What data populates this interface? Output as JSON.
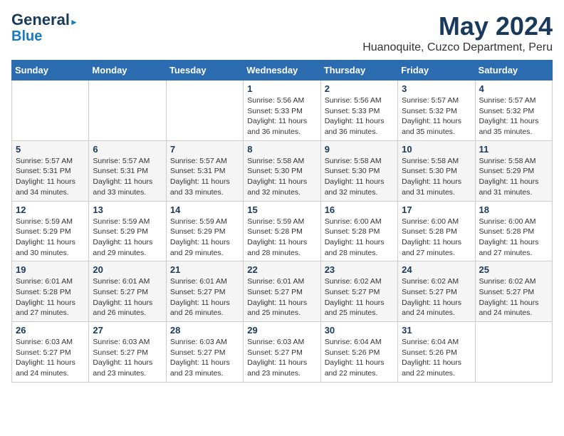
{
  "header": {
    "logo_line1": "General",
    "logo_line2": "Blue",
    "title": "May 2024",
    "subtitle": "Huanoquite, Cuzco Department, Peru"
  },
  "weekdays": [
    "Sunday",
    "Monday",
    "Tuesday",
    "Wednesday",
    "Thursday",
    "Friday",
    "Saturday"
  ],
  "weeks": [
    [
      {
        "day": "",
        "info": ""
      },
      {
        "day": "",
        "info": ""
      },
      {
        "day": "",
        "info": ""
      },
      {
        "day": "1",
        "info": "Sunrise: 5:56 AM\nSunset: 5:33 PM\nDaylight: 11 hours and 36 minutes."
      },
      {
        "day": "2",
        "info": "Sunrise: 5:56 AM\nSunset: 5:33 PM\nDaylight: 11 hours and 36 minutes."
      },
      {
        "day": "3",
        "info": "Sunrise: 5:57 AM\nSunset: 5:32 PM\nDaylight: 11 hours and 35 minutes."
      },
      {
        "day": "4",
        "info": "Sunrise: 5:57 AM\nSunset: 5:32 PM\nDaylight: 11 hours and 35 minutes."
      }
    ],
    [
      {
        "day": "5",
        "info": "Sunrise: 5:57 AM\nSunset: 5:31 PM\nDaylight: 11 hours and 34 minutes."
      },
      {
        "day": "6",
        "info": "Sunrise: 5:57 AM\nSunset: 5:31 PM\nDaylight: 11 hours and 33 minutes."
      },
      {
        "day": "7",
        "info": "Sunrise: 5:57 AM\nSunset: 5:31 PM\nDaylight: 11 hours and 33 minutes."
      },
      {
        "day": "8",
        "info": "Sunrise: 5:58 AM\nSunset: 5:30 PM\nDaylight: 11 hours and 32 minutes."
      },
      {
        "day": "9",
        "info": "Sunrise: 5:58 AM\nSunset: 5:30 PM\nDaylight: 11 hours and 32 minutes."
      },
      {
        "day": "10",
        "info": "Sunrise: 5:58 AM\nSunset: 5:30 PM\nDaylight: 11 hours and 31 minutes."
      },
      {
        "day": "11",
        "info": "Sunrise: 5:58 AM\nSunset: 5:29 PM\nDaylight: 11 hours and 31 minutes."
      }
    ],
    [
      {
        "day": "12",
        "info": "Sunrise: 5:59 AM\nSunset: 5:29 PM\nDaylight: 11 hours and 30 minutes."
      },
      {
        "day": "13",
        "info": "Sunrise: 5:59 AM\nSunset: 5:29 PM\nDaylight: 11 hours and 29 minutes."
      },
      {
        "day": "14",
        "info": "Sunrise: 5:59 AM\nSunset: 5:29 PM\nDaylight: 11 hours and 29 minutes."
      },
      {
        "day": "15",
        "info": "Sunrise: 5:59 AM\nSunset: 5:28 PM\nDaylight: 11 hours and 28 minutes."
      },
      {
        "day": "16",
        "info": "Sunrise: 6:00 AM\nSunset: 5:28 PM\nDaylight: 11 hours and 28 minutes."
      },
      {
        "day": "17",
        "info": "Sunrise: 6:00 AM\nSunset: 5:28 PM\nDaylight: 11 hours and 27 minutes."
      },
      {
        "day": "18",
        "info": "Sunrise: 6:00 AM\nSunset: 5:28 PM\nDaylight: 11 hours and 27 minutes."
      }
    ],
    [
      {
        "day": "19",
        "info": "Sunrise: 6:01 AM\nSunset: 5:28 PM\nDaylight: 11 hours and 27 minutes."
      },
      {
        "day": "20",
        "info": "Sunrise: 6:01 AM\nSunset: 5:27 PM\nDaylight: 11 hours and 26 minutes."
      },
      {
        "day": "21",
        "info": "Sunrise: 6:01 AM\nSunset: 5:27 PM\nDaylight: 11 hours and 26 minutes."
      },
      {
        "day": "22",
        "info": "Sunrise: 6:01 AM\nSunset: 5:27 PM\nDaylight: 11 hours and 25 minutes."
      },
      {
        "day": "23",
        "info": "Sunrise: 6:02 AM\nSunset: 5:27 PM\nDaylight: 11 hours and 25 minutes."
      },
      {
        "day": "24",
        "info": "Sunrise: 6:02 AM\nSunset: 5:27 PM\nDaylight: 11 hours and 24 minutes."
      },
      {
        "day": "25",
        "info": "Sunrise: 6:02 AM\nSunset: 5:27 PM\nDaylight: 11 hours and 24 minutes."
      }
    ],
    [
      {
        "day": "26",
        "info": "Sunrise: 6:03 AM\nSunset: 5:27 PM\nDaylight: 11 hours and 24 minutes."
      },
      {
        "day": "27",
        "info": "Sunrise: 6:03 AM\nSunset: 5:27 PM\nDaylight: 11 hours and 23 minutes."
      },
      {
        "day": "28",
        "info": "Sunrise: 6:03 AM\nSunset: 5:27 PM\nDaylight: 11 hours and 23 minutes."
      },
      {
        "day": "29",
        "info": "Sunrise: 6:03 AM\nSunset: 5:27 PM\nDaylight: 11 hours and 23 minutes."
      },
      {
        "day": "30",
        "info": "Sunrise: 6:04 AM\nSunset: 5:26 PM\nDaylight: 11 hours and 22 minutes."
      },
      {
        "day": "31",
        "info": "Sunrise: 6:04 AM\nSunset: 5:26 PM\nDaylight: 11 hours and 22 minutes."
      },
      {
        "day": "",
        "info": ""
      }
    ]
  ]
}
